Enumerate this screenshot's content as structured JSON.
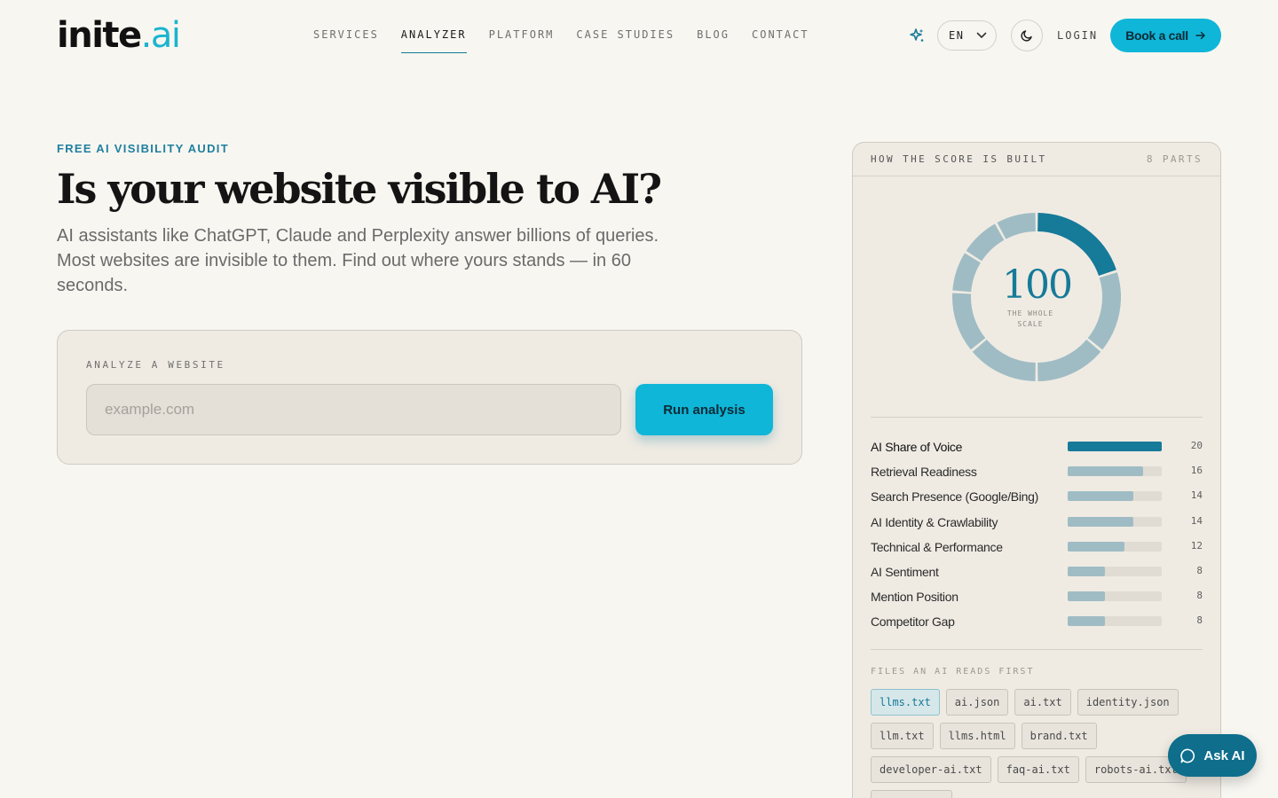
{
  "brand": {
    "name": "inite",
    "accent": ".ai"
  },
  "nav": {
    "links": [
      "SERVICES",
      "ANALYZER",
      "PLATFORM",
      "CASE STUDIES",
      "BLOG",
      "CONTACT"
    ],
    "active": "ANALYZER",
    "language": "EN",
    "login": "LOGIN",
    "cta": "Book a call"
  },
  "hero": {
    "eyebrow": "FREE AI VISIBILITY AUDIT",
    "title": "Is your website visible to AI?",
    "lede": "AI assistants like ChatGPT, Claude and Perplexity answer billions of queries. Most websites are invisible to them. Find out where yours stands — in 60 seconds."
  },
  "analyzer": {
    "label": "ANALYZE A WEBSITE",
    "input_value": "",
    "placeholder": "example.com",
    "button": "Run analysis"
  },
  "score_panel": {
    "title": "HOW THE SCORE IS BUILT",
    "count": "8 PARTS",
    "total": "100",
    "total_caption_line1": "THE WHOLE",
    "total_caption_line2": "SCALE",
    "parts": [
      {
        "label": "AI Share of Voice",
        "value": 20
      },
      {
        "label": "Retrieval Readiness",
        "value": 16
      },
      {
        "label": "Search Presence (Google/Bing)",
        "value": 14
      },
      {
        "label": "AI Identity & Crawlability",
        "value": 14
      },
      {
        "label": "Technical & Performance",
        "value": 12
      },
      {
        "label": "AI Sentiment",
        "value": 8
      },
      {
        "label": "Mention Position",
        "value": 8
      },
      {
        "label": "Competitor Gap",
        "value": 8
      }
    ],
    "files_title": "FILES AN AI READS FIRST",
    "files": [
      "llms.txt",
      "ai.json",
      "ai.txt",
      "identity.json",
      "llm.txt",
      "llms.html",
      "brand.txt",
      "developer-ai.txt",
      "faq-ai.txt",
      "robots-ai.txt",
      ""
    ],
    "active_file": "llms.txt"
  },
  "ask": {
    "label": "Ask AI"
  },
  "colors": {
    "accent": "#0fb6d8",
    "primary_dark": "#167a99",
    "muted_segment": "#9fbcc4",
    "background": "#f8f6f1"
  }
}
